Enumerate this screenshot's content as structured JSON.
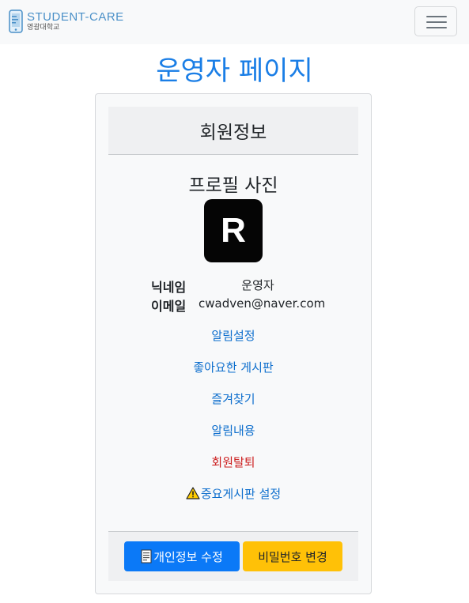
{
  "header": {
    "brand_name": "STUDENT-CARE",
    "brand_sub": "영광대학교",
    "menu_icon": "hamburger-menu-icon"
  },
  "page": {
    "title": "운영자 페이지"
  },
  "profile_card": {
    "header_title": "회원정보",
    "photo_title": "프로필 사진",
    "avatar_letter": "R",
    "nickname_label": "닉네임",
    "nickname_value": "운영자",
    "email_label": "이메일",
    "email_value": "cwadven@naver.com"
  },
  "menu": {
    "notification_settings": "알림설정",
    "liked_posts": "좋아요한 게시판",
    "favorites": "즐겨찾기",
    "notification_history": "알림내용",
    "withdraw": "회원탈퇴",
    "important_board_settings": "중요게시판 설정"
  },
  "buttons": {
    "edit_profile": "개인정보 수정",
    "change_password": "비밀번호 변경"
  },
  "colors": {
    "primary": "#0b79f7",
    "warning": "#ffc107",
    "link": "#0d6ecd",
    "danger": "#cc1f1f",
    "title": "#1a7ee6"
  }
}
